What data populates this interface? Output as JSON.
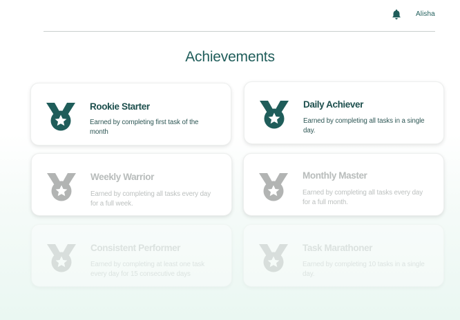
{
  "header": {
    "notification_icon": "bell-icon",
    "username": "Alisha"
  },
  "page": {
    "title": "Achievements"
  },
  "colors": {
    "primary": "#1f5d5a",
    "earned_medal": "#1f5d5a",
    "locked_medal": "#b2b4b3",
    "background_tint": "#eaf7f2"
  },
  "achievements": [
    {
      "title": "Rookie Starter",
      "description": "Earned by completing first task of the month",
      "status": "earned",
      "icon": "medal-icon"
    },
    {
      "title": "Daily Achiever",
      "description": "Earned by completing all tasks in a single day.",
      "status": "earned",
      "icon": "medal-icon"
    },
    {
      "title": "Weekly Warrior",
      "description": "Earned by completing all tasks every day for a full week.",
      "status": "locked",
      "icon": "medal-icon"
    },
    {
      "title": "Monthly Master",
      "description": "Earned by completing all tasks every day for a full month.",
      "status": "locked",
      "icon": "medal-icon"
    },
    {
      "title": "Consistent Performer",
      "description": "Earned by completing at least one task every day for 15 consecutive days",
      "status": "locked",
      "icon": "medal-icon"
    },
    {
      "title": "Task Marathoner",
      "description": "Earned by completing 10 tasks in a single day.",
      "status": "locked",
      "icon": "medal-icon"
    }
  ]
}
